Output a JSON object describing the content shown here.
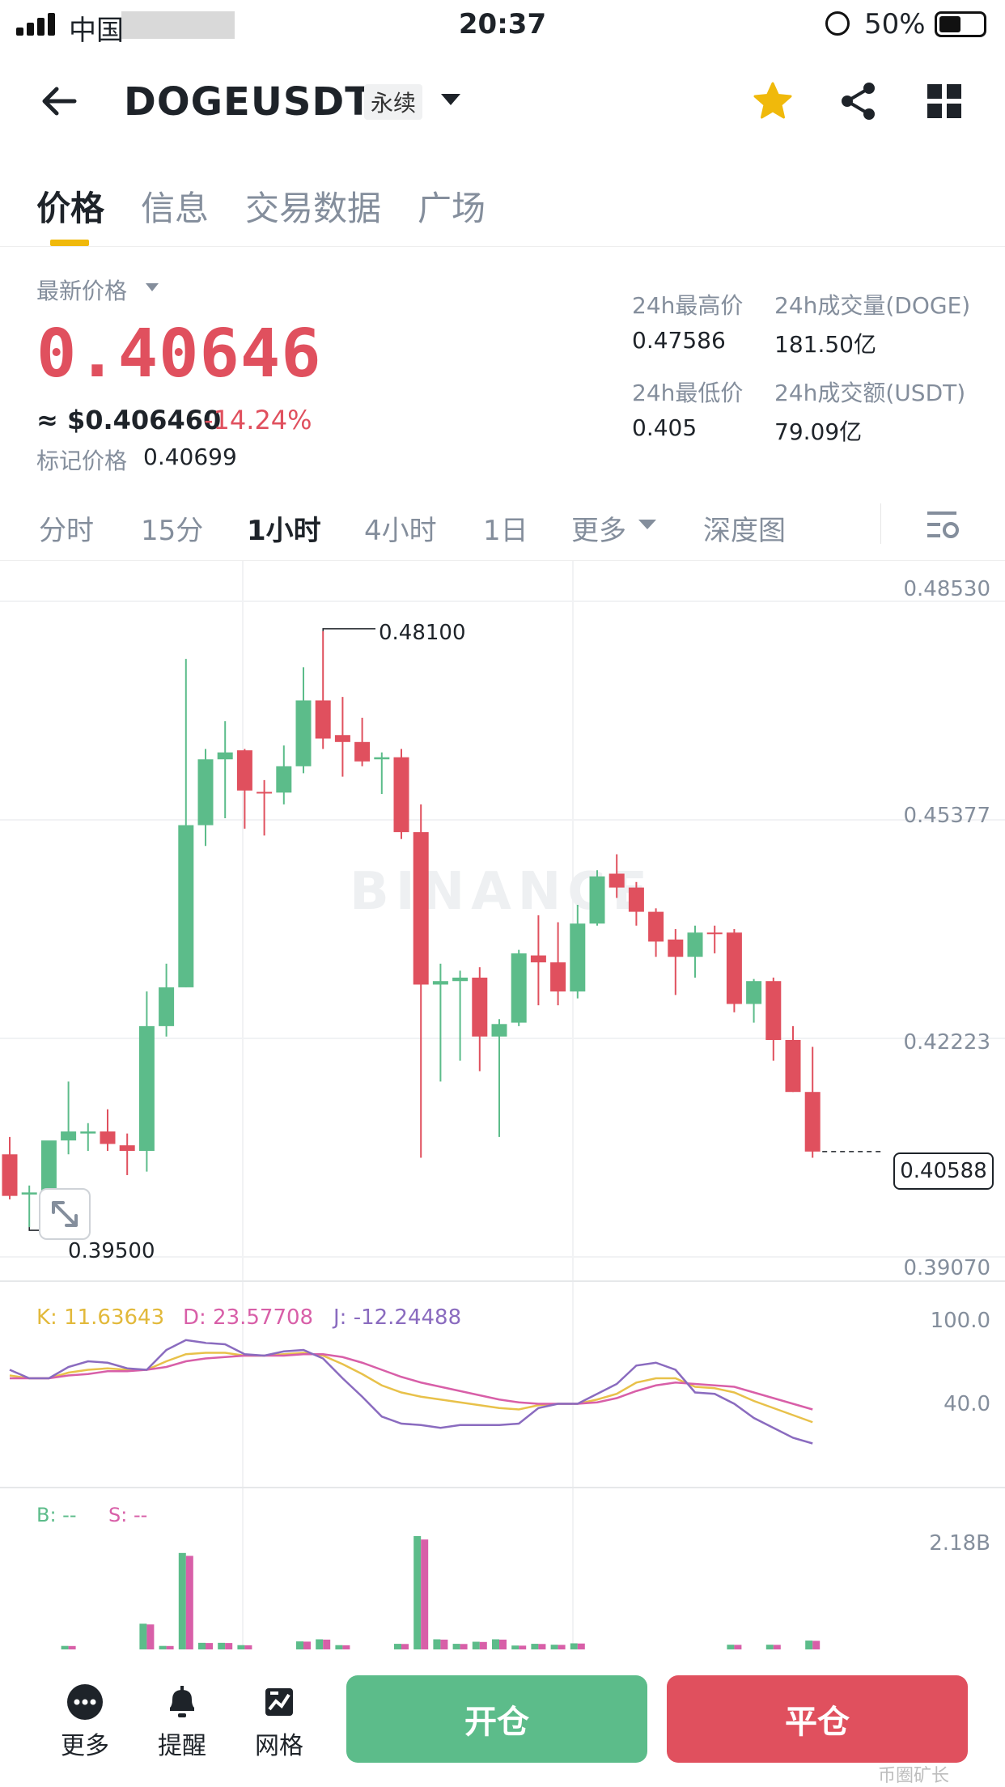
{
  "status_bar": {
    "carrier": "中国",
    "time": "20:37",
    "battery": "50%"
  },
  "header": {
    "symbol": "DOGEUSDT",
    "contract_type": "永续"
  },
  "tabs": [
    {
      "label": "价格",
      "active": true
    },
    {
      "label": "信息",
      "active": false
    },
    {
      "label": "交易数据",
      "active": false
    },
    {
      "label": "广场",
      "active": false
    }
  ],
  "price_info": {
    "latest_label": "最新价格",
    "last_price": "0.40646",
    "usd_value": "≈ $0.406460",
    "change_pct": "-14.24%",
    "mark_label": "标记价格",
    "mark_price": "0.40699",
    "high_label": "24h最高价",
    "high": "0.47586",
    "low_label": "24h最低价",
    "low": "0.405",
    "vol_label": "24h成交量(DOGE)",
    "vol": "181.50亿",
    "amt_label": "24h成交额(USDT)",
    "amt": "79.09亿"
  },
  "intervals": [
    {
      "label": "分时",
      "active": false
    },
    {
      "label": "15分",
      "active": false
    },
    {
      "label": "1小时",
      "active": true
    },
    {
      "label": "4小时",
      "active": false
    },
    {
      "label": "1日",
      "active": false
    },
    {
      "label": "更多",
      "active": false
    },
    {
      "label": "深度图",
      "active": false
    }
  ],
  "chart_data": {
    "type": "candlestick",
    "watermark": "BINANCE",
    "y_axis": [
      "0.48530",
      "0.45377",
      "0.42223",
      "0.39070"
    ],
    "ylim": [
      0.3907,
      0.4853
    ],
    "max_marker": "0.48100",
    "min_marker": "0.39500",
    "current_price_label": "0.40588",
    "candles": [
      {
        "o": 0.4055,
        "h": 0.408,
        "l": 0.399,
        "c": 0.3995
      },
      {
        "o": 0.3997,
        "h": 0.401,
        "l": 0.395,
        "c": 0.4
      },
      {
        "o": 0.4,
        "h": 0.407,
        "l": 0.399,
        "c": 0.4075
      },
      {
        "o": 0.4075,
        "h": 0.416,
        "l": 0.4055,
        "c": 0.4088
      },
      {
        "o": 0.4085,
        "h": 0.41,
        "l": 0.406,
        "c": 0.4088
      },
      {
        "o": 0.4088,
        "h": 0.412,
        "l": 0.406,
        "c": 0.407
      },
      {
        "o": 0.4068,
        "h": 0.4085,
        "l": 0.4025,
        "c": 0.406
      },
      {
        "o": 0.406,
        "h": 0.429,
        "l": 0.403,
        "c": 0.424
      },
      {
        "o": 0.424,
        "h": 0.433,
        "l": 0.4225,
        "c": 0.4296
      },
      {
        "o": 0.4296,
        "h": 0.477,
        "l": 0.4296,
        "c": 0.453
      },
      {
        "o": 0.453,
        "h": 0.464,
        "l": 0.45,
        "c": 0.4625
      },
      {
        "o": 0.4625,
        "h": 0.468,
        "l": 0.454,
        "c": 0.4635
      },
      {
        "o": 0.4638,
        "h": 0.464,
        "l": 0.4525,
        "c": 0.458
      },
      {
        "o": 0.4578,
        "h": 0.4595,
        "l": 0.4515,
        "c": 0.4577
      },
      {
        "o": 0.4577,
        "h": 0.4645,
        "l": 0.456,
        "c": 0.4615
      },
      {
        "o": 0.4615,
        "h": 0.4758,
        "l": 0.4605,
        "c": 0.471
      },
      {
        "o": 0.471,
        "h": 0.481,
        "l": 0.464,
        "c": 0.4655
      },
      {
        "o": 0.466,
        "h": 0.4715,
        "l": 0.46,
        "c": 0.465
      },
      {
        "o": 0.465,
        "h": 0.4685,
        "l": 0.4615,
        "c": 0.4622
      },
      {
        "o": 0.4625,
        "h": 0.4635,
        "l": 0.4575,
        "c": 0.4628
      },
      {
        "o": 0.4628,
        "h": 0.464,
        "l": 0.451,
        "c": 0.452
      },
      {
        "o": 0.452,
        "h": 0.456,
        "l": 0.405,
        "c": 0.43
      },
      {
        "o": 0.43,
        "h": 0.433,
        "l": 0.416,
        "c": 0.4305
      },
      {
        "o": 0.4305,
        "h": 0.432,
        "l": 0.419,
        "c": 0.431
      },
      {
        "o": 0.431,
        "h": 0.4325,
        "l": 0.4175,
        "c": 0.4225
      },
      {
        "o": 0.4225,
        "h": 0.425,
        "l": 0.408,
        "c": 0.4243
      },
      {
        "o": 0.4245,
        "h": 0.435,
        "l": 0.424,
        "c": 0.4345
      },
      {
        "o": 0.4342,
        "h": 0.44,
        "l": 0.427,
        "c": 0.4332
      },
      {
        "o": 0.4332,
        "h": 0.439,
        "l": 0.427,
        "c": 0.429
      },
      {
        "o": 0.429,
        "h": 0.4415,
        "l": 0.428,
        "c": 0.4388
      },
      {
        "o": 0.4388,
        "h": 0.4465,
        "l": 0.4385,
        "c": 0.4456
      },
      {
        "o": 0.446,
        "h": 0.4488,
        "l": 0.4425,
        "c": 0.444
      },
      {
        "o": 0.444,
        "h": 0.4448,
        "l": 0.4385,
        "c": 0.4405
      },
      {
        "o": 0.4405,
        "h": 0.441,
        "l": 0.434,
        "c": 0.4362
      },
      {
        "o": 0.4365,
        "h": 0.438,
        "l": 0.4285,
        "c": 0.434
      },
      {
        "o": 0.434,
        "h": 0.4385,
        "l": 0.431,
        "c": 0.4375
      },
      {
        "o": 0.4375,
        "h": 0.4385,
        "l": 0.4345,
        "c": 0.4373
      },
      {
        "o": 0.4375,
        "h": 0.438,
        "l": 0.426,
        "c": 0.4272
      },
      {
        "o": 0.4272,
        "h": 0.4308,
        "l": 0.4245,
        "c": 0.4305
      },
      {
        "o": 0.4305,
        "h": 0.431,
        "l": 0.419,
        "c": 0.422
      },
      {
        "o": 0.422,
        "h": 0.424,
        "l": 0.4145,
        "c": 0.4145
      },
      {
        "o": 0.4145,
        "h": 0.421,
        "l": 0.405,
        "c": 0.4059
      }
    ]
  },
  "kdj": {
    "k_label": "K: 11.63643",
    "d_label": "D: 23.57708",
    "j_label": "J: -12.24488",
    "axis": [
      "100.0",
      "40.0"
    ],
    "k": [
      72,
      70,
      70,
      74,
      76,
      77,
      76,
      76,
      82,
      87,
      88,
      88,
      86,
      86,
      87,
      88,
      86,
      80,
      73,
      65,
      60,
      57,
      55,
      53,
      51,
      49,
      48,
      51,
      52,
      52,
      55,
      59,
      67,
      70,
      70,
      64,
      63,
      60,
      54,
      49,
      44,
      39
    ],
    "d": [
      70,
      70,
      70,
      72,
      73,
      75,
      75,
      76,
      78,
      82,
      84,
      85,
      86,
      86,
      86,
      87,
      87,
      85,
      81,
      76,
      71,
      67,
      64,
      61,
      58,
      55,
      53,
      52,
      52,
      52,
      53,
      56,
      61,
      65,
      67,
      66,
      65,
      64,
      60,
      56,
      52,
      48
    ],
    "j": [
      76,
      70,
      70,
      78,
      82,
      81,
      77,
      76,
      90,
      97,
      95,
      94,
      87,
      86,
      89,
      90,
      84,
      70,
      57,
      43,
      38,
      37,
      35,
      37,
      37,
      37,
      38,
      49,
      52,
      52,
      59,
      66,
      79,
      81,
      76,
      60,
      59,
      52,
      42,
      35,
      28,
      24
    ]
  },
  "volume": {
    "b_label": "B: --",
    "s_label": "S: --",
    "axis": "2.18B"
  },
  "bottom_bar": {
    "more": "更多",
    "alert": "提醒",
    "grid": "网格",
    "open": "开仓",
    "close": "平仓"
  },
  "colors": {
    "up": "#5cbc8a",
    "down": "#e0505e",
    "accent": "#f0b90b",
    "k": "#e8c14a",
    "d": "#d85fa8",
    "j": "#8a6bbf"
  },
  "watermark": "币圈矿长"
}
